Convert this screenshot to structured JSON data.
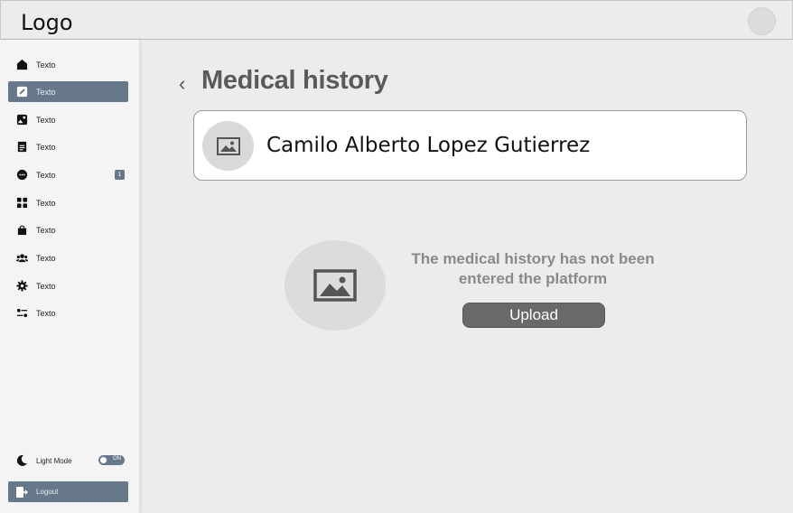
{
  "header": {
    "logo": "Logo"
  },
  "sidebar": {
    "items": [
      {
        "label": "Texto",
        "icon": "home-icon",
        "active": false
      },
      {
        "label": "Texto",
        "icon": "edit-icon",
        "active": true
      },
      {
        "label": "Texto",
        "icon": "photo-icon",
        "active": false
      },
      {
        "label": "Texto",
        "icon": "document-icon",
        "active": false
      },
      {
        "label": "Texto",
        "icon": "chat-icon",
        "active": false,
        "badge": "1"
      },
      {
        "label": "Texto",
        "icon": "grid-icon",
        "active": false
      },
      {
        "label": "Texto",
        "icon": "bag-icon",
        "active": false
      },
      {
        "label": "Texto",
        "icon": "users-icon",
        "active": false
      },
      {
        "label": "Texto",
        "icon": "gear-icon",
        "active": false
      },
      {
        "label": "Texto",
        "icon": "sliders-icon",
        "active": false
      }
    ],
    "light_mode_label": "Light Mode",
    "toggle_label": "ON",
    "logout_label": "Logout"
  },
  "main": {
    "back_glyph": "‹",
    "title": "Medical history",
    "patient_name": "Camilo Alberto Lopez Gutierrez",
    "empty_message": "The medical history has not been entered the platform",
    "upload_label": "Upload"
  },
  "colors": {
    "accent": "#66788a",
    "upload_button": "#6b6869",
    "background": "#ececec"
  }
}
